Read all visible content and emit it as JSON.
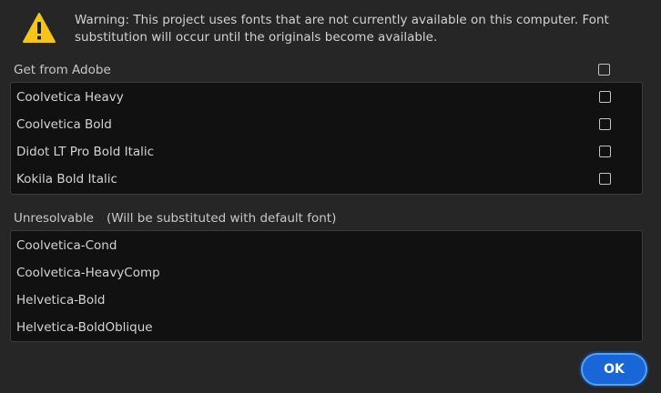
{
  "warning": {
    "icon": "warning-triangle-icon",
    "message": "Warning: This project uses fonts that are not currently available on this computer. Font substitution will occur until the originals become available.",
    "icon_color": "#f5c518"
  },
  "adobe_section": {
    "label": "Get from Adobe",
    "fonts": [
      {
        "name": "Coolvetica Heavy",
        "checked": false
      },
      {
        "name": "Coolvetica Bold",
        "checked": false
      },
      {
        "name": "Didot LT Pro Bold Italic",
        "checked": false
      },
      {
        "name": "Kokila Bold Italic",
        "checked": false
      }
    ]
  },
  "unresolvable_section": {
    "label": "Unresolvable",
    "note": "(Will be substituted with default font)",
    "fonts": [
      "Coolvetica-Cond",
      "Coolvetica-HeavyComp",
      "Helvetica-Bold",
      "Helvetica-BoldOblique"
    ]
  },
  "buttons": {
    "ok_label": "OK",
    "accent": "#1866d8"
  }
}
